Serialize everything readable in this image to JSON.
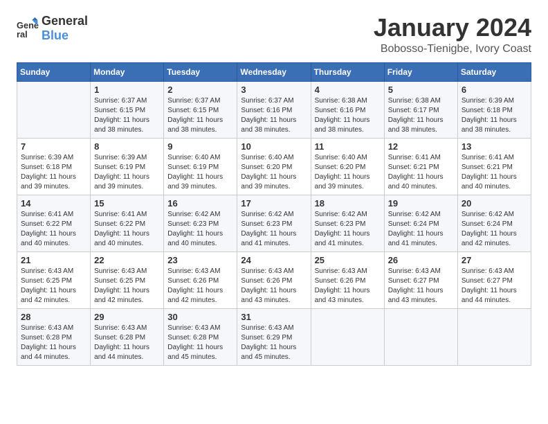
{
  "header": {
    "logo_line1": "General",
    "logo_line2": "Blue",
    "month": "January 2024",
    "location": "Bobosso-Tienigbe, Ivory Coast"
  },
  "days_of_week": [
    "Sunday",
    "Monday",
    "Tuesday",
    "Wednesday",
    "Thursday",
    "Friday",
    "Saturday"
  ],
  "weeks": [
    [
      {
        "day": "",
        "info": ""
      },
      {
        "day": "1",
        "info": "Sunrise: 6:37 AM\nSunset: 6:15 PM\nDaylight: 11 hours\nand 38 minutes."
      },
      {
        "day": "2",
        "info": "Sunrise: 6:37 AM\nSunset: 6:15 PM\nDaylight: 11 hours\nand 38 minutes."
      },
      {
        "day": "3",
        "info": "Sunrise: 6:37 AM\nSunset: 6:16 PM\nDaylight: 11 hours\nand 38 minutes."
      },
      {
        "day": "4",
        "info": "Sunrise: 6:38 AM\nSunset: 6:16 PM\nDaylight: 11 hours\nand 38 minutes."
      },
      {
        "day": "5",
        "info": "Sunrise: 6:38 AM\nSunset: 6:17 PM\nDaylight: 11 hours\nand 38 minutes."
      },
      {
        "day": "6",
        "info": "Sunrise: 6:39 AM\nSunset: 6:18 PM\nDaylight: 11 hours\nand 38 minutes."
      }
    ],
    [
      {
        "day": "7",
        "info": "Sunrise: 6:39 AM\nSunset: 6:18 PM\nDaylight: 11 hours\nand 39 minutes."
      },
      {
        "day": "8",
        "info": "Sunrise: 6:39 AM\nSunset: 6:19 PM\nDaylight: 11 hours\nand 39 minutes."
      },
      {
        "day": "9",
        "info": "Sunrise: 6:40 AM\nSunset: 6:19 PM\nDaylight: 11 hours\nand 39 minutes."
      },
      {
        "day": "10",
        "info": "Sunrise: 6:40 AM\nSunset: 6:20 PM\nDaylight: 11 hours\nand 39 minutes."
      },
      {
        "day": "11",
        "info": "Sunrise: 6:40 AM\nSunset: 6:20 PM\nDaylight: 11 hours\nand 39 minutes."
      },
      {
        "day": "12",
        "info": "Sunrise: 6:41 AM\nSunset: 6:21 PM\nDaylight: 11 hours\nand 40 minutes."
      },
      {
        "day": "13",
        "info": "Sunrise: 6:41 AM\nSunset: 6:21 PM\nDaylight: 11 hours\nand 40 minutes."
      }
    ],
    [
      {
        "day": "14",
        "info": "Sunrise: 6:41 AM\nSunset: 6:22 PM\nDaylight: 11 hours\nand 40 minutes."
      },
      {
        "day": "15",
        "info": "Sunrise: 6:41 AM\nSunset: 6:22 PM\nDaylight: 11 hours\nand 40 minutes."
      },
      {
        "day": "16",
        "info": "Sunrise: 6:42 AM\nSunset: 6:23 PM\nDaylight: 11 hours\nand 40 minutes."
      },
      {
        "day": "17",
        "info": "Sunrise: 6:42 AM\nSunset: 6:23 PM\nDaylight: 11 hours\nand 41 minutes."
      },
      {
        "day": "18",
        "info": "Sunrise: 6:42 AM\nSunset: 6:23 PM\nDaylight: 11 hours\nand 41 minutes."
      },
      {
        "day": "19",
        "info": "Sunrise: 6:42 AM\nSunset: 6:24 PM\nDaylight: 11 hours\nand 41 minutes."
      },
      {
        "day": "20",
        "info": "Sunrise: 6:42 AM\nSunset: 6:24 PM\nDaylight: 11 hours\nand 42 minutes."
      }
    ],
    [
      {
        "day": "21",
        "info": "Sunrise: 6:43 AM\nSunset: 6:25 PM\nDaylight: 11 hours\nand 42 minutes."
      },
      {
        "day": "22",
        "info": "Sunrise: 6:43 AM\nSunset: 6:25 PM\nDaylight: 11 hours\nand 42 minutes."
      },
      {
        "day": "23",
        "info": "Sunrise: 6:43 AM\nSunset: 6:26 PM\nDaylight: 11 hours\nand 42 minutes."
      },
      {
        "day": "24",
        "info": "Sunrise: 6:43 AM\nSunset: 6:26 PM\nDaylight: 11 hours\nand 43 minutes."
      },
      {
        "day": "25",
        "info": "Sunrise: 6:43 AM\nSunset: 6:26 PM\nDaylight: 11 hours\nand 43 minutes."
      },
      {
        "day": "26",
        "info": "Sunrise: 6:43 AM\nSunset: 6:27 PM\nDaylight: 11 hours\nand 43 minutes."
      },
      {
        "day": "27",
        "info": "Sunrise: 6:43 AM\nSunset: 6:27 PM\nDaylight: 11 hours\nand 44 minutes."
      }
    ],
    [
      {
        "day": "28",
        "info": "Sunrise: 6:43 AM\nSunset: 6:28 PM\nDaylight: 11 hours\nand 44 minutes."
      },
      {
        "day": "29",
        "info": "Sunrise: 6:43 AM\nSunset: 6:28 PM\nDaylight: 11 hours\nand 44 minutes."
      },
      {
        "day": "30",
        "info": "Sunrise: 6:43 AM\nSunset: 6:28 PM\nDaylight: 11 hours\nand 45 minutes."
      },
      {
        "day": "31",
        "info": "Sunrise: 6:43 AM\nSunset: 6:29 PM\nDaylight: 11 hours\nand 45 minutes."
      },
      {
        "day": "",
        "info": ""
      },
      {
        "day": "",
        "info": ""
      },
      {
        "day": "",
        "info": ""
      }
    ]
  ]
}
